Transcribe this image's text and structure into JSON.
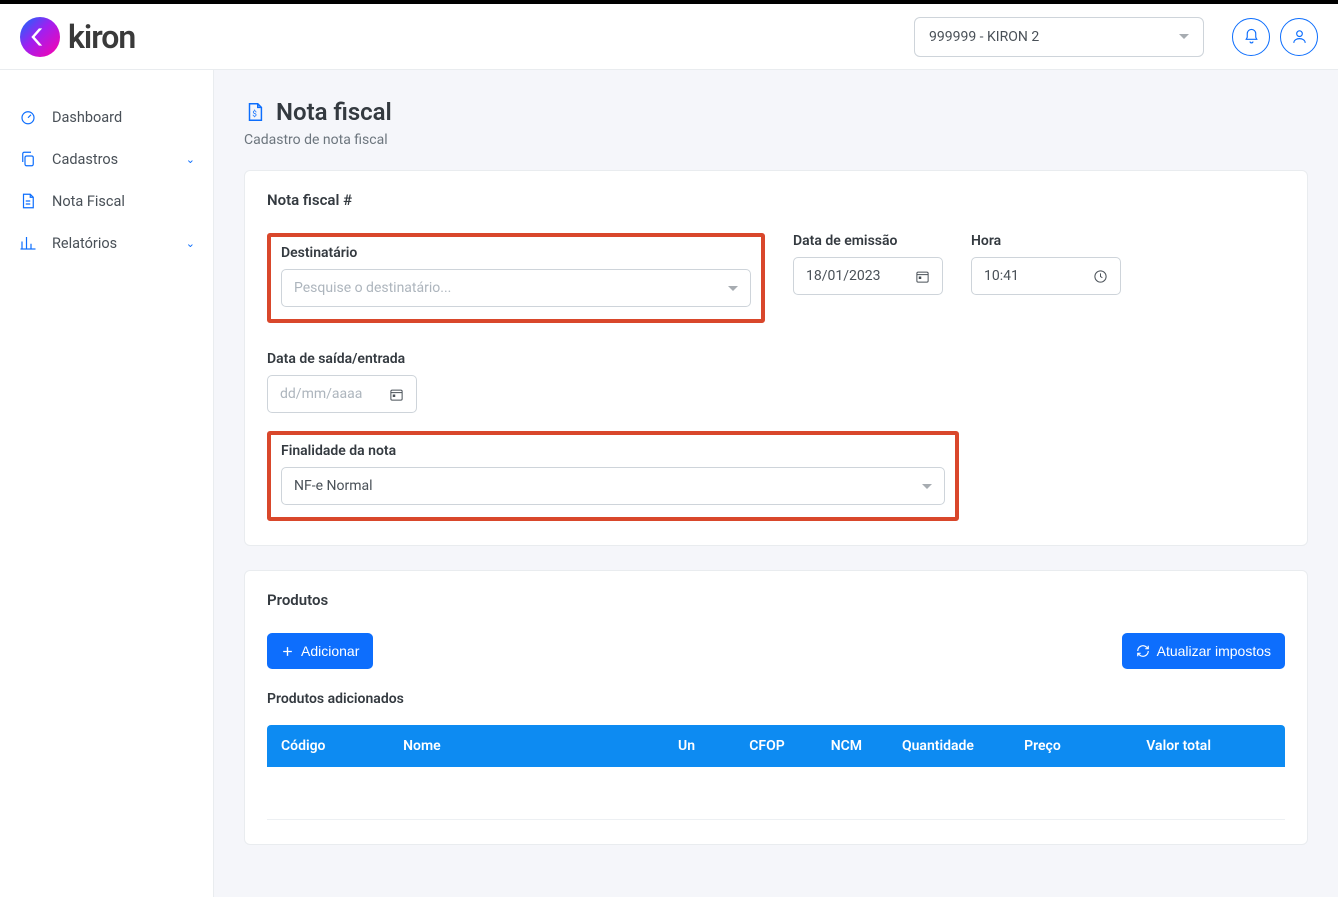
{
  "header": {
    "brand": "kiron",
    "company_selected": "999999 - KIRON 2"
  },
  "sidebar": {
    "items": [
      {
        "label": "Dashboard",
        "icon": "dashboard",
        "expandable": false
      },
      {
        "label": "Cadastros",
        "icon": "copy",
        "expandable": true
      },
      {
        "label": "Nota Fiscal",
        "icon": "doc",
        "expandable": false
      },
      {
        "label": "Relatórios",
        "icon": "chart",
        "expandable": true
      }
    ]
  },
  "page": {
    "title": "Nota fiscal",
    "subtitle": "Cadastro de nota fiscal"
  },
  "form": {
    "card_title": "Nota fiscal #",
    "destinatario": {
      "label": "Destinatário",
      "placeholder": "Pesquise o destinatário..."
    },
    "data_emissao": {
      "label": "Data de emissão",
      "value": "18/01/2023"
    },
    "hora": {
      "label": "Hora",
      "value": "10:41"
    },
    "data_saida": {
      "label": "Data de saída/entrada",
      "placeholder": "dd/mm/aaaa"
    },
    "finalidade": {
      "label": "Finalidade da nota",
      "value": "NF-e Normal"
    }
  },
  "products": {
    "title": "Produtos",
    "add_label": "Adicionar",
    "refresh_label": "Atualizar impostos",
    "added_label": "Produtos adicionados",
    "columns": [
      "Código",
      "Nome",
      "Un",
      "CFOP",
      "NCM",
      "Quantidade",
      "Preço",
      "Valor total"
    ]
  }
}
